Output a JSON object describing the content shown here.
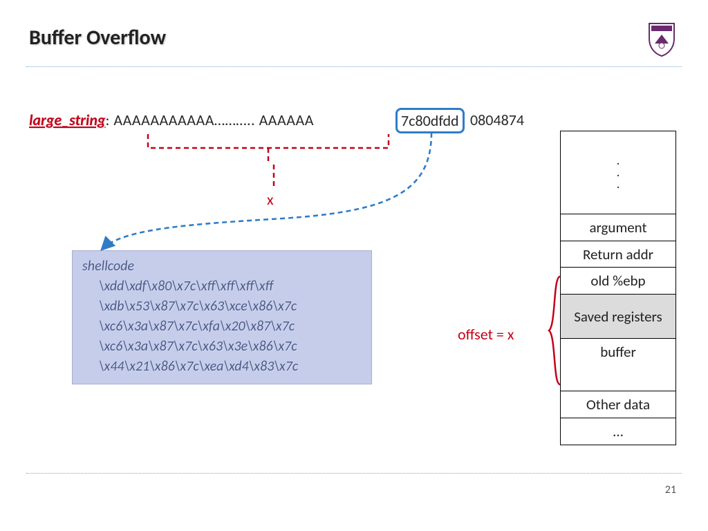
{
  "title": "Buffer Overflow",
  "page_number": "21",
  "large_string": {
    "label": "large_string",
    "colon": ": ",
    "prefix": "AAAAAAAAAAA……….. AAAAAA",
    "boxed_addr": "7c80dfdd",
    "suffix": "0804874"
  },
  "x_label": "x",
  "offset_label": "offset = x",
  "shellcode": {
    "head": "shellcode",
    "lines": [
      "\\xdd\\xdf\\x80\\x7c\\xff\\xff\\xff\\xff",
      "\\xdb\\x53\\x87\\x7c\\x63\\xce\\x86\\x7c",
      "\\xc6\\x3a\\x87\\x7c\\xfa\\x20\\x87\\x7c",
      "\\xc6\\x3a\\x87\\x7c\\x63\\x3e\\x86\\x7c",
      "\\x44\\x21\\x86\\x7c\\xea\\xd4\\x83\\x7c"
    ]
  },
  "stack": {
    "argument": "argument",
    "return_addr": "Return addr",
    "old_ebp": "old %ebp",
    "saved_registers": "Saved registers",
    "buffer": "buffer",
    "other_data": "Other data",
    "ellipsis": "…",
    "dot": "."
  }
}
